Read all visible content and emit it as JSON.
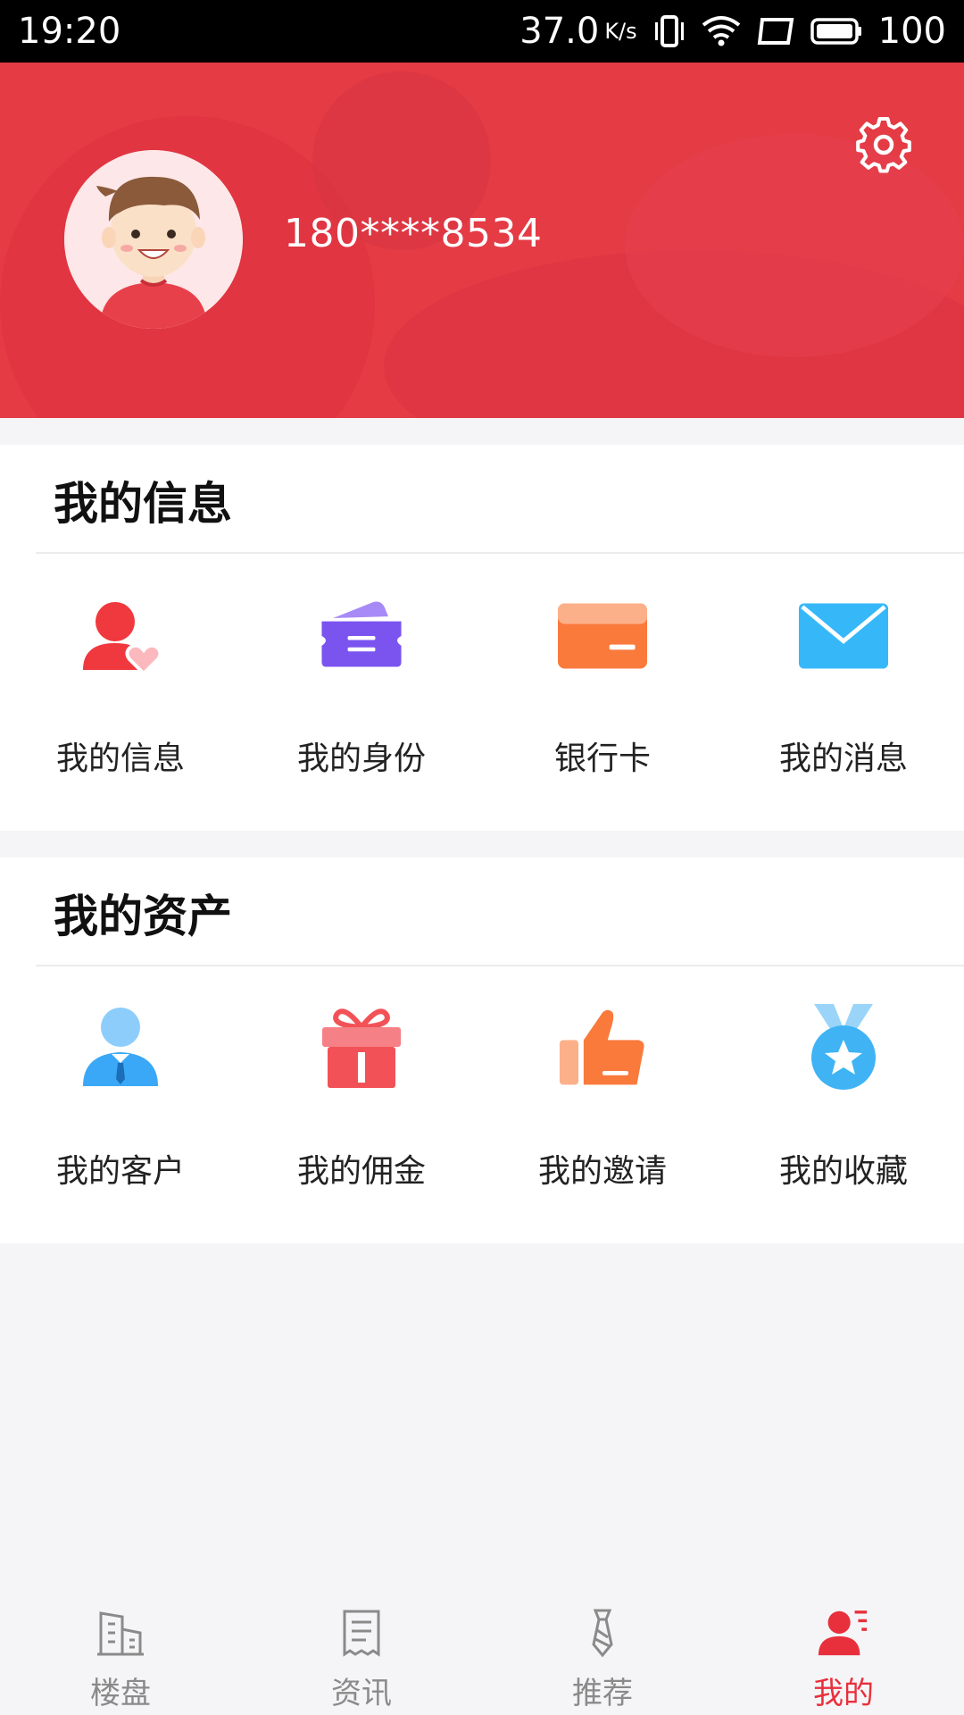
{
  "status_bar": {
    "time": "19:20",
    "speed": "37.0",
    "speed_unit": "K/s",
    "battery": "100",
    "icons": [
      "vibrate-icon",
      "wifi-icon",
      "screen-icon",
      "battery-icon"
    ]
  },
  "profile": {
    "phone": "180****8534",
    "avatar_icon": "avatar-boy-icon",
    "settings_icon": "gear-icon"
  },
  "my_info": {
    "title": "我的信息",
    "items": [
      {
        "label": "我的信息",
        "icon": "user-heart-icon",
        "color": "#f0383f"
      },
      {
        "label": "我的身份",
        "icon": "ticket-icon",
        "color": "#7b54f0"
      },
      {
        "label": "银行卡",
        "icon": "bank-card-icon",
        "color": "#fa7a3c"
      },
      {
        "label": "我的消息",
        "icon": "envelope-icon",
        "color": "#36b8f8"
      }
    ]
  },
  "my_assets": {
    "title": "我的资产",
    "items": [
      {
        "label": "我的客户",
        "icon": "customer-icon",
        "color": "#3aa8f6"
      },
      {
        "label": "我的佣金",
        "icon": "gift-icon",
        "color": "#f25257"
      },
      {
        "label": "我的邀请",
        "icon": "thumbs-up-icon",
        "color": "#fa7a3c"
      },
      {
        "label": "我的收藏",
        "icon": "medal-icon",
        "color": "#3fb3f4"
      }
    ]
  },
  "tab_bar": {
    "tabs": [
      {
        "label": "楼盘",
        "icon": "building-icon",
        "active": false
      },
      {
        "label": "资讯",
        "icon": "news-icon",
        "active": false
      },
      {
        "label": "推荐",
        "icon": "tie-icon",
        "active": false
      },
      {
        "label": "我的",
        "icon": "user-list-icon",
        "active": true
      }
    ],
    "active_color": "#e8303c",
    "inactive_color": "#8a8a8a"
  }
}
